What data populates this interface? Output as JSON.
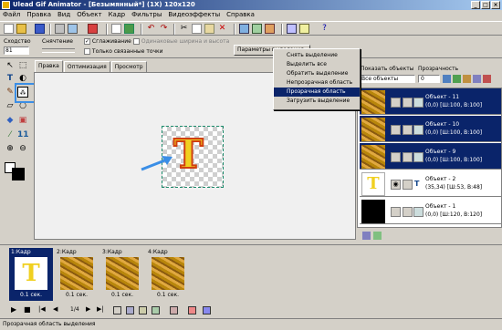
{
  "titlebar": {
    "title": "Ulead Gif Animator - [Безымянный*] (1X) 120x120"
  },
  "menu": [
    "Файл",
    "Правка",
    "Вид",
    "Объект",
    "Кадр",
    "Фильтры",
    "Видеоэффекты",
    "Справка"
  ],
  "toolbar2": {
    "similarity_label": "Сходство",
    "similarity_value": "81",
    "removal_label": "Снячтение",
    "smoothing_label": "Сглаживание",
    "same_width_height_label": "Одинаковые ширина и высота",
    "only_linked_label": "Только связанные точки",
    "params_button": "Параметры выделения"
  },
  "tabs": [
    "Правка",
    "Оптимизация",
    "Просмотр"
  ],
  "context_menu": [
    {
      "label": "Снять выделение"
    },
    {
      "label": "Выделить все"
    },
    {
      "label": "Обратить выделение"
    },
    {
      "label": "Непрозрачная область"
    },
    {
      "label": "Прозрачная область",
      "selected": true
    },
    {
      "label": "Загрузить выделение"
    }
  ],
  "objects_panel": {
    "show_label": "Показать объекты",
    "show_value": "Все объекты",
    "opacity_label": "Прозрачность",
    "opacity_value": "0",
    "objects": [
      {
        "name": "Объект - 11",
        "info": "(0,0) [Ш:100, В:100]",
        "selected": true
      },
      {
        "name": "Объект - 10",
        "info": "(0,0) [Ш:100, В:100]",
        "selected": true
      },
      {
        "name": "Объект - 9",
        "info": "(0,0) [Ш:100, В:100]",
        "selected": true
      },
      {
        "name": "Объект - 2",
        "info": "(35,34) [Ш:53, В:48]",
        "selected": false
      },
      {
        "name": "Объект - 1",
        "info": "(0,0) [Ш:120, В:120]",
        "selected": false
      }
    ]
  },
  "frames": [
    {
      "label": "1:Кадр",
      "delay": "0.1 сек."
    },
    {
      "label": "2:Кадр",
      "delay": "0.1 сек."
    },
    {
      "label": "3:Кадр",
      "delay": "0.1 сек."
    },
    {
      "label": "4:Кадр",
      "delay": "0.1 сек."
    }
  ],
  "playback": {
    "counter": "1/4"
  },
  "statusbar": {
    "text": "Прозрачная область выделения"
  },
  "canvas": {
    "letter": "T"
  },
  "colors": {
    "selection": "#0a246a",
    "highlight": "#3a8ee6",
    "face": "#d4d0c8"
  }
}
